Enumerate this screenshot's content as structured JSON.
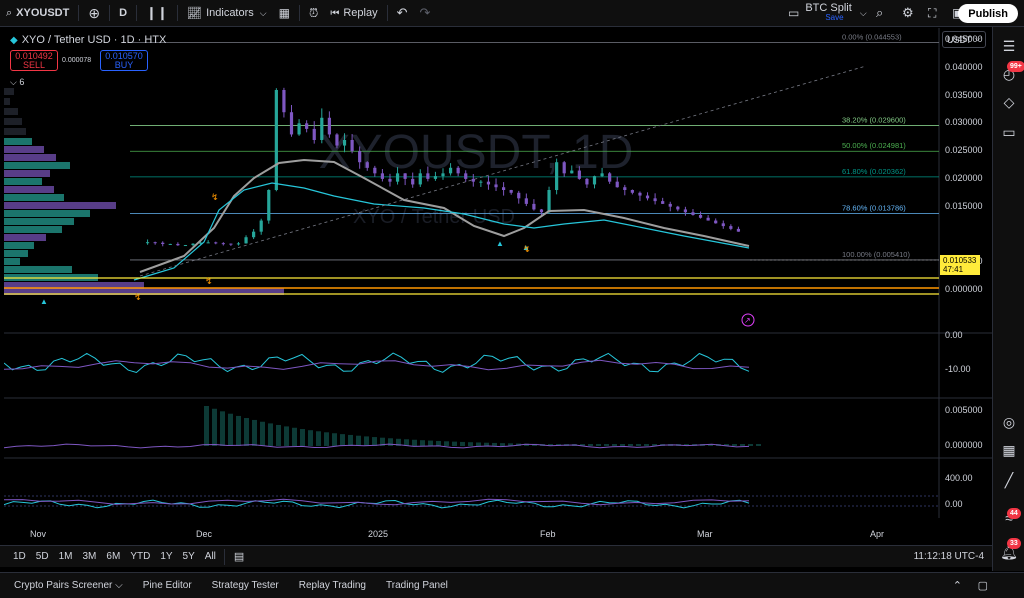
{
  "toolbar": {
    "symbol": "XYOUSDT",
    "interval": "D",
    "indicators": "Indicators",
    "replay": "Replay",
    "btc_split": "BTC Split",
    "save": "Save",
    "publish": "Publish"
  },
  "legend": {
    "title": "XYO / Tether USD · 1D · HTX",
    "sell_price": "0.010492",
    "sell_label": "SELL",
    "spread": "0.000078",
    "buy_price": "0.010570",
    "buy_label": "BUY",
    "indicator_count": "6",
    "currency": "USDT"
  },
  "watermark": {
    "symbol": "XYOUSDT, 1D",
    "name": "XYO / Tether USD"
  },
  "price_axis": [
    "0.045000",
    "0.040000",
    "0.035000",
    "0.030000",
    "0.025000",
    "0.020000",
    "0.015000",
    "0.005000",
    "0.000000"
  ],
  "current_price": {
    "value": "0.010533",
    "countdown": "47:41"
  },
  "fib_levels": [
    {
      "label": "0.00% (0.044553)",
      "price": 0.044553,
      "color": "#787b86"
    },
    {
      "label": "38.20% (0.029600)",
      "price": 0.0296,
      "color": "#81c784"
    },
    {
      "label": "50.00% (0.024981)",
      "price": 0.024981,
      "color": "#4caf50"
    },
    {
      "label": "61.80% (0.020362)",
      "price": 0.020362,
      "color": "#009688"
    },
    {
      "label": "78.60% (0.013786)",
      "price": 0.013786,
      "color": "#64b5f6"
    },
    {
      "label": "100.00% (0.005410)",
      "price": 0.00541,
      "color": "#787b86"
    }
  ],
  "osc1_axis": [
    "0.00",
    "-10.00"
  ],
  "osc2_axis": [
    "0.005000",
    "0.000000"
  ],
  "osc3_axis": [
    "400.00",
    "0.00"
  ],
  "time_axis": [
    "Nov",
    "Dec",
    "2025",
    "Feb",
    "Mar",
    "Apr"
  ],
  "timeframes": [
    "1D",
    "5D",
    "1M",
    "3M",
    "6M",
    "YTD",
    "1Y",
    "5Y",
    "All"
  ],
  "clock": "11:12:18 UTC-4",
  "bottom_tabs": [
    "Crypto Pairs Screener",
    "Pine Editor",
    "Strategy Tester",
    "Replay Trading",
    "Trading Panel"
  ],
  "sidebar_badges": {
    "alerts": "99+",
    "ideas": "44",
    "notifications": "33"
  },
  "colors": {
    "up": "#26a69a",
    "down": "#7e57c2",
    "ma": "#9e9e9e",
    "accent": "#2962ff"
  }
}
